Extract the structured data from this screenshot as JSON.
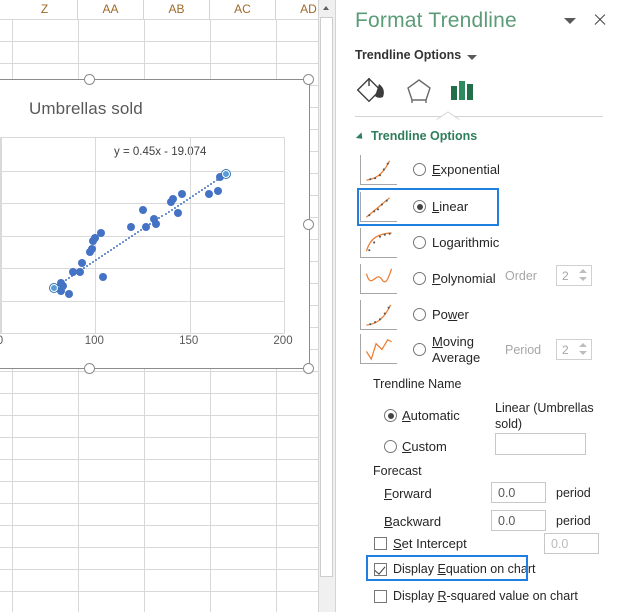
{
  "spreadsheet": {
    "columns": [
      "Z",
      "AA",
      "AB",
      "AC",
      "AD"
    ]
  },
  "chart": {
    "title": "Umbrellas sold",
    "equation": "y = 0.45x - 19.074",
    "x_ticks": [
      "0",
      "100",
      "150",
      "200"
    ]
  },
  "chart_data": {
    "type": "scatter",
    "title": "Umbrellas sold",
    "xlabel": "",
    "ylabel": "",
    "xlim": [
      50,
      200
    ],
    "ylim": [
      0,
      70
    ],
    "grid": true,
    "legend": "none",
    "annotations": [
      "y = 0.45x - 19.074"
    ],
    "trendline": {
      "type": "linear",
      "slope": 0.45,
      "intercept": -19.074,
      "style": "dotted",
      "color": "#4472c4"
    },
    "series": [
      {
        "name": "Umbrellas sold",
        "color": "#4472c4",
        "points": [
          [
            82,
            18
          ],
          [
            83,
            17
          ],
          [
            82,
            15
          ],
          [
            86,
            14
          ],
          [
            88,
            22
          ],
          [
            92,
            22
          ],
          [
            93,
            25
          ],
          [
            97,
            29
          ],
          [
            98,
            30
          ],
          [
            99,
            33
          ],
          [
            100,
            34
          ],
          [
            103,
            36
          ],
          [
            104,
            20
          ],
          [
            119,
            38
          ],
          [
            125,
            44
          ],
          [
            127,
            38
          ],
          [
            131,
            41
          ],
          [
            132,
            39
          ],
          [
            140,
            47
          ],
          [
            141,
            48
          ],
          [
            144,
            43
          ],
          [
            146,
            50
          ],
          [
            160,
            50
          ],
          [
            165,
            51
          ],
          [
            166,
            56
          ]
        ]
      }
    ]
  },
  "pane": {
    "title": "Format Trendline",
    "menu_icon": "chevron-down-icon",
    "close_icon": "close-icon",
    "subhead": "Trendline Options",
    "subhead_caret_icon": "chevron-down-icon",
    "icons": [
      {
        "name": "fill-and-line-icon",
        "label": "Fill & Line",
        "selected": false
      },
      {
        "name": "effects-icon",
        "label": "Effects",
        "selected": false
      },
      {
        "name": "trendline-options-icon",
        "label": "Trendline Options",
        "selected": true
      }
    ],
    "section_title": "Trendline Options",
    "trendline_types": [
      {
        "id": "exponential",
        "label": "Exponential",
        "mnemonic": "E",
        "selected": false,
        "highlighted": false
      },
      {
        "id": "linear",
        "label": "Linear",
        "mnemonic": "L",
        "selected": true,
        "highlighted": true
      },
      {
        "id": "logarithmic",
        "label": "Logarithmic",
        "mnemonic": "g",
        "selected": false,
        "highlighted": false
      },
      {
        "id": "polynomial",
        "label": "Polynomial",
        "mnemonic": "P",
        "selected": false,
        "highlighted": false
      },
      {
        "id": "power",
        "label": "Power",
        "mnemonic": "w",
        "selected": false,
        "highlighted": false
      },
      {
        "id": "moving-average",
        "label": "Moving Average",
        "mnemonic": "M",
        "selected": false,
        "highlighted": false
      }
    ],
    "order": {
      "label": "Order",
      "value": "2"
    },
    "period": {
      "label": "Period",
      "value": "2"
    },
    "trendline_name": {
      "heading": "Trendline Name",
      "automatic_label": "Automatic",
      "automatic_selected": true,
      "automatic_value": "Linear (Umbrellas sold)",
      "custom_label": "Custom",
      "custom_selected": false,
      "custom_value": ""
    },
    "forecast": {
      "heading": "Forecast",
      "forward_label": "Forward",
      "forward_value": "0.0",
      "forward_unit": "period",
      "backward_label": "Backward",
      "backward_value": "0.0",
      "backward_unit": "period"
    },
    "set_intercept": {
      "label": "Set Intercept",
      "checked": false,
      "value": "0.0"
    },
    "display_equation": {
      "label": "Display Equation on chart",
      "checked": true,
      "highlighted": true
    },
    "display_rsquared": {
      "label": "Display R-squared value on chart",
      "checked": false
    }
  },
  "colors": {
    "pane_title": "#5b9c77",
    "section_title": "#2e7d5b",
    "highlight": "#1e7fe0",
    "series": "#4472c4",
    "thumbnail_curve": "#ed7d31"
  }
}
